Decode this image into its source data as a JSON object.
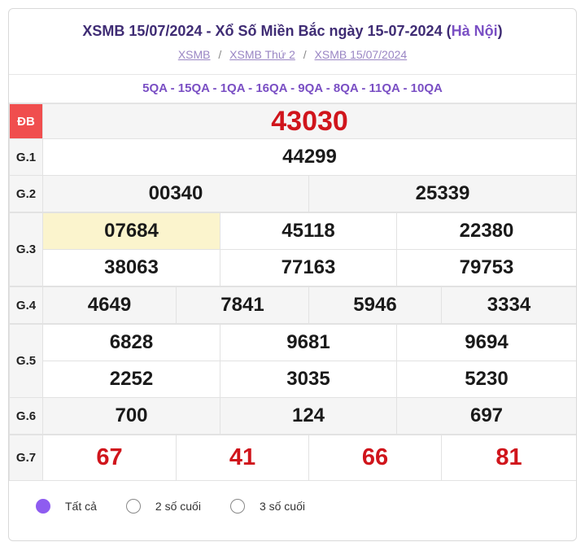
{
  "header": {
    "title_main": "XSMB 15/07/2024 - Xổ Số Miền Bắc ngày 15-07-2024",
    "title_paren_open": "(",
    "title_place": "Hà Nội",
    "title_paren_close": ")",
    "breadcrumbs": [
      "XSMB",
      "XSMB Thứ 2",
      "XSMB 15/07/2024"
    ],
    "breadcrumb_separator": "/"
  },
  "codes": "5QA - 15QA - 1QA - 16QA - 9QA - 8QA - 11QA - 10QA",
  "results": {
    "db": {
      "label": "ĐB",
      "numbers": [
        "43030"
      ]
    },
    "g1": {
      "label": "G.1",
      "numbers": [
        "44299"
      ]
    },
    "g2": {
      "label": "G.2",
      "numbers": [
        "00340",
        "25339"
      ]
    },
    "g3": {
      "label": "G.3",
      "numbers": [
        "07684",
        "45118",
        "22380",
        "38063",
        "77163",
        "79753"
      ]
    },
    "g4": {
      "label": "G.4",
      "numbers": [
        "4649",
        "7841",
        "5946",
        "3334"
      ]
    },
    "g5": {
      "label": "G.5",
      "numbers": [
        "6828",
        "9681",
        "9694",
        "2252",
        "3035",
        "5230"
      ]
    },
    "g6": {
      "label": "G.6",
      "numbers": [
        "700",
        "124",
        "697"
      ]
    },
    "g7": {
      "label": "G.7",
      "numbers": [
        "67",
        "41",
        "66",
        "81"
      ]
    }
  },
  "filters": {
    "options": [
      "Tất cả",
      "2 số cuối",
      "3 số cuối"
    ],
    "selected": "Tất cả"
  },
  "colors": {
    "title": "#3f2c74",
    "accent_purple": "#7a4fc4",
    "db_label_bg": "#f04e4e",
    "prize_red": "#d0151c",
    "highlight_cell": "#fbf4cd",
    "radio_selected": "#8e5cf0"
  }
}
